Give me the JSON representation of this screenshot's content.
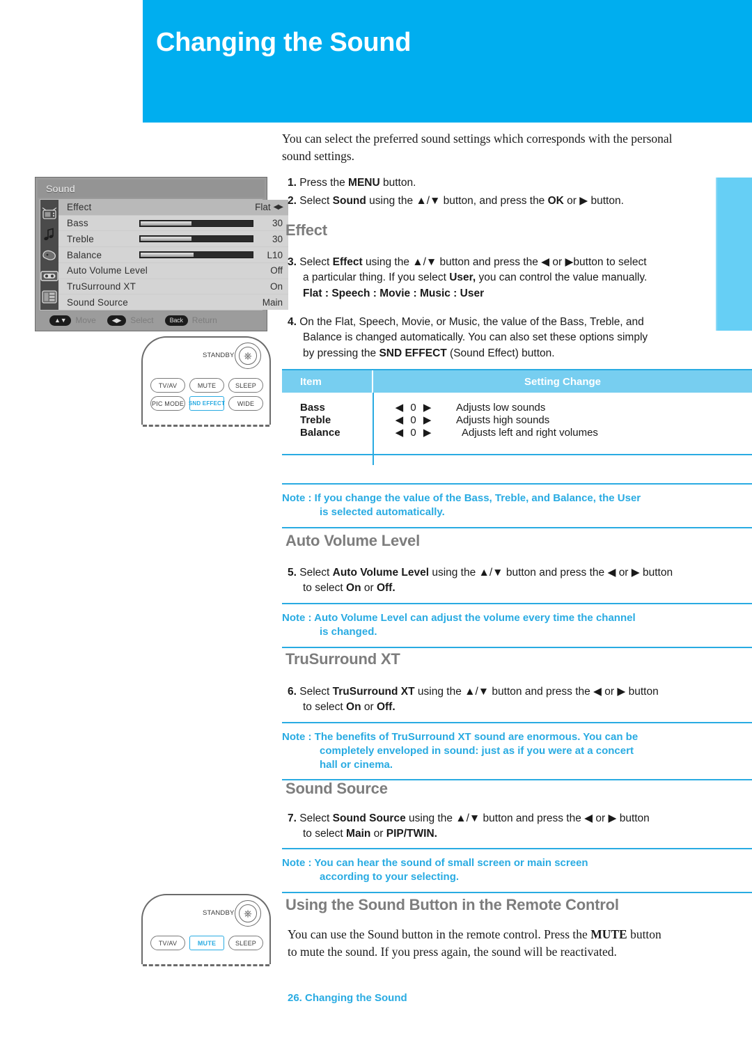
{
  "header": {
    "title": "Changing the Sound"
  },
  "osd": {
    "title": "Sound",
    "icons": [
      "tv-icon",
      "music-note-icon",
      "speech-icon",
      "cassette-icon",
      "multi-pane-icon"
    ],
    "rows": [
      {
        "label": "Effect",
        "type": "option",
        "value": "Flat",
        "arrows": "◀▶",
        "selected": true
      },
      {
        "label": "Bass",
        "type": "slider",
        "value": "30",
        "fill": 45
      },
      {
        "label": "Treble",
        "type": "slider",
        "value": "30",
        "fill": 45
      },
      {
        "label": "Balance",
        "type": "slider",
        "value": "L10",
        "fill": 47
      },
      {
        "label": "Auto Volume Level",
        "type": "option",
        "value": "Off"
      },
      {
        "label": "TruSurround XT",
        "type": "option",
        "value": "On"
      },
      {
        "label": "Sound Source",
        "type": "option",
        "value": "Main"
      }
    ],
    "footer": [
      {
        "key": "▲▼",
        "label": "Move",
        "pill": false
      },
      {
        "key": "◀▶",
        "label": "Select",
        "pill": false
      },
      {
        "key": "Back",
        "label": "Return",
        "pill": true
      }
    ]
  },
  "remote_top": {
    "standby_label": "STANDBY",
    "power_icon": "power-icon",
    "row1": [
      {
        "label": "TV/AV",
        "highlighted": false
      },
      {
        "label": "MUTE",
        "highlighted": false
      },
      {
        "label": "SLEEP",
        "highlighted": false
      }
    ],
    "row2": [
      {
        "label": "PIC MODE",
        "highlighted": false
      },
      {
        "label": "SND EFFECT",
        "highlighted": true
      },
      {
        "label": "WIDE",
        "highlighted": false
      }
    ]
  },
  "remote_bottom": {
    "standby_label": "STANDBY",
    "power_icon": "power-icon",
    "row1": [
      {
        "label": "TV/AV",
        "highlighted": false
      },
      {
        "label": "MUTE",
        "highlighted": true
      },
      {
        "label": "SLEEP",
        "highlighted": false
      }
    ]
  },
  "intro": {
    "line1": "You can select the preferred sound settings which corresponds with the personal",
    "line2": "sound settings."
  },
  "steps_top": [
    {
      "num": "1.",
      "html": "Press the <b>MENU</b> button."
    },
    {
      "num": "2.",
      "html": "Select <b>Sound</b> using the ▲/▼ button, and press the <b>OK</b> or ▶ button."
    }
  ],
  "effect": {
    "heading": "Effect",
    "step3_num": "3.",
    "step3_l1": "Select <b>Effect</b> using the ▲/▼ button and press the ◀ or ▶button to select",
    "step3_l2": "a particular thing. If you select <b>User,</b> you can control the value manually.",
    "step3_l3": "<b>Flat : Speech : Movie : Music : User</b>",
    "step4_num": "4.",
    "step4_l1": "On the Flat, Speech, Movie, or Music, the value of the Bass, Treble, and",
    "step4_l2": "Balance is changed automatically. You can also set these options simply",
    "step4_l3": "by pressing the <b>SND EFFECT</b> (Sound Effect) button."
  },
  "table": {
    "headers": [
      "Item",
      "Setting Change"
    ],
    "rows": [
      {
        "item": "Bass",
        "control": "◀ 0 ▶",
        "desc": "Adjusts low sounds"
      },
      {
        "item": "Treble",
        "control": "◀ 0 ▶",
        "desc": "Adjusts high sounds"
      },
      {
        "item": "Balance",
        "control": "◀ 0 ▶",
        "desc": "Adjusts left and right volumes"
      }
    ]
  },
  "note1": {
    "l1": "Note : If you change the value of the Bass, Treble, and Balance, the User",
    "l2": "is selected automatically."
  },
  "auto_volume": {
    "heading": "Auto Volume Level",
    "step_num": "5.",
    "l1": "Select <b>Auto Volume Level</b> using the ▲/▼ button and press the ◀ or ▶ button",
    "l2": "to select <b>On</b> or <b>Off.</b>"
  },
  "note2": {
    "l1": "Note : Auto Volume Level can adjust the volume every time the channel",
    "l2": "is changed."
  },
  "trusurround": {
    "heading": "TruSurround XT",
    "step_num": "6.",
    "l1": "Select <b>TruSurround XT</b> using the ▲/▼ button and press the ◀ or ▶ button",
    "l2": "to select <b>On</b> or <b>Off.</b>"
  },
  "note3": {
    "l1": "Note : The benefits of TruSurround XT sound are enormous. You can be",
    "l2": "completely enveloped in sound: just as if you were at a concert",
    "l3": "hall or cinema."
  },
  "sound_source": {
    "heading": "Sound Source",
    "step_num": "7.",
    "l1": "Select <b>Sound Source</b> using the ▲/▼ button and press the ◀ or ▶ button",
    "l2": "to select <b>Main</b> or <b>PIP/TWIN.</b>"
  },
  "note4": {
    "l1": "Note : You can hear the sound of small screen or main screen",
    "l2": "according to your selecting."
  },
  "remote_section": {
    "heading": "Using the Sound Button in the Remote Control",
    "l1": "You can use the Sound button in the remote control. Press the <b>MUTE</b> button",
    "l2": "to mute the sound. If you press again, the sound will be reactivated."
  },
  "footer": {
    "page": "26. Changing the Sound"
  },
  "colors": {
    "brand_blue": "#00AEEF",
    "note_blue": "#29ABE2",
    "tab_blue": "#66CFF5",
    "table_header": "#77CEF0",
    "heading_gray": "#7D7D7D"
  }
}
